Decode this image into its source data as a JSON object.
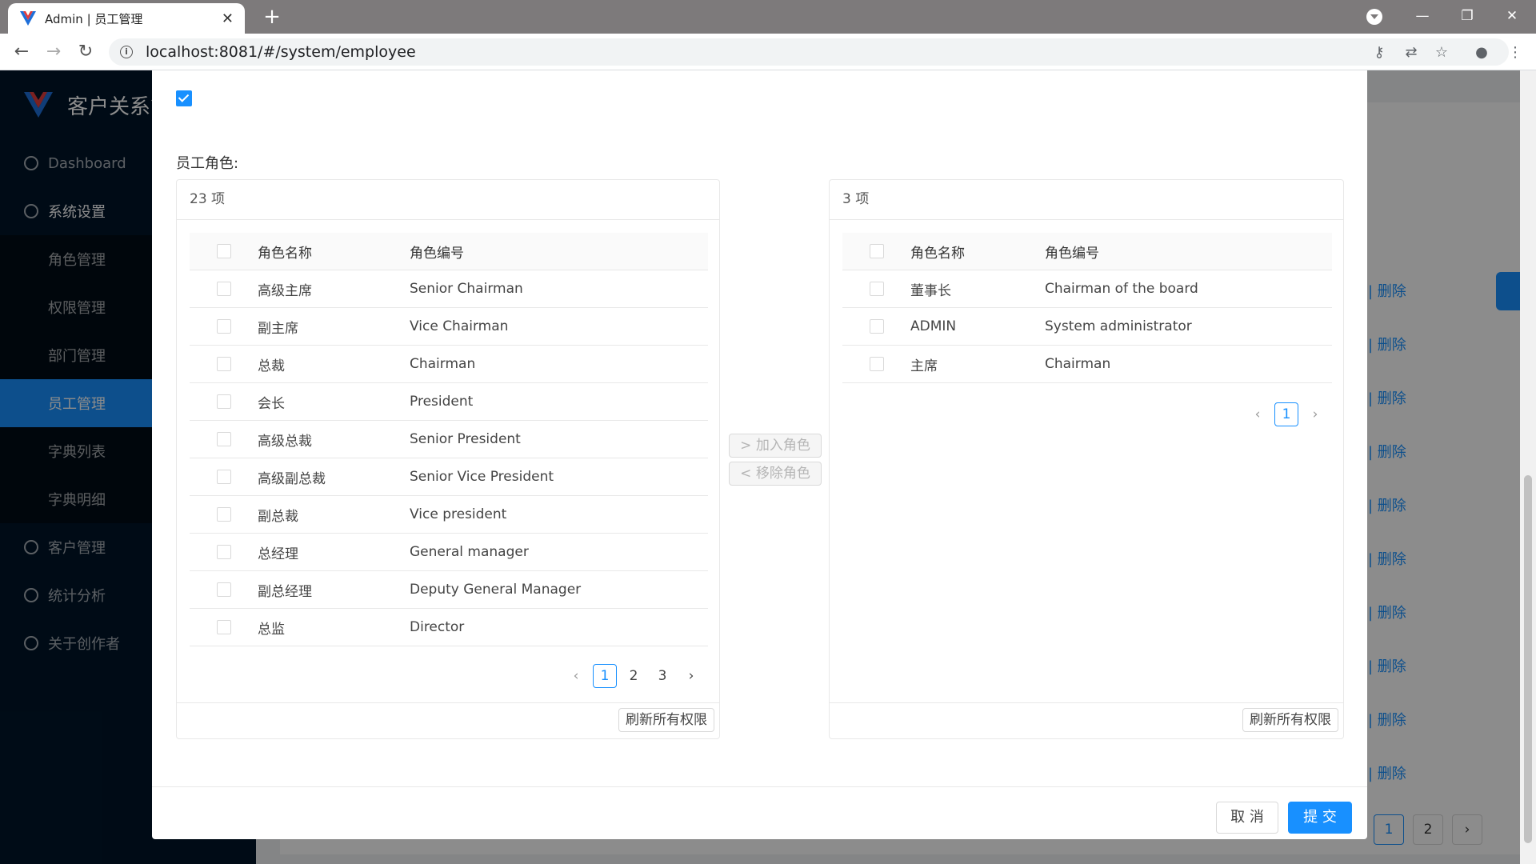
{
  "browser": {
    "tab_title": "Admin | 员工管理",
    "tab_close": "✕",
    "new_tab": "+",
    "url": "localhost:8081/#/system/employee"
  },
  "sidebar": {
    "brand": "客户关系管理",
    "items": [
      {
        "label": "Dashboard"
      },
      {
        "label": "系统设置"
      }
    ],
    "subitems": [
      {
        "label": "角色管理"
      },
      {
        "label": "权限管理"
      },
      {
        "label": "部门管理"
      },
      {
        "label": "员工管理"
      },
      {
        "label": "字典列表"
      },
      {
        "label": "字典明细"
      }
    ],
    "items_after": [
      {
        "label": "客户管理"
      },
      {
        "label": "统计分析"
      },
      {
        "label": "关于创作者"
      }
    ]
  },
  "background": {
    "delete_link": "| 删除",
    "pages": [
      "1",
      "2"
    ]
  },
  "modal": {
    "roles_label": "员工角色:",
    "left_panel": {
      "count": "23 项",
      "headers": {
        "name": "角色名称",
        "code": "角色编号"
      },
      "rows": [
        {
          "name": "高级主席",
          "code": "Senior Chairman"
        },
        {
          "name": "副主席",
          "code": "Vice Chairman"
        },
        {
          "name": "总裁",
          "code": "Chairman"
        },
        {
          "name": "会长",
          "code": "President"
        },
        {
          "name": "高级总裁",
          "code": "Senior President"
        },
        {
          "name": "高级副总裁",
          "code": "Senior Vice President"
        },
        {
          "name": "副总裁",
          "code": "Vice president"
        },
        {
          "name": "总经理",
          "code": "General manager"
        },
        {
          "name": "副总经理",
          "code": "Deputy General Manager"
        },
        {
          "name": "总监",
          "code": "Director"
        }
      ],
      "pager": {
        "pages": [
          "1",
          "2",
          "3"
        ],
        "current": "1"
      },
      "refresh": "刷新所有权限"
    },
    "right_panel": {
      "count": "3 项",
      "headers": {
        "name": "角色名称",
        "code": "角色编号"
      },
      "rows": [
        {
          "name": "董事长",
          "code": "Chairman of the board"
        },
        {
          "name": "ADMIN",
          "code": "System administrator"
        },
        {
          "name": "主席",
          "code": "Chairman"
        }
      ],
      "pager": {
        "pages": [
          "1"
        ],
        "current": "1"
      },
      "refresh": "刷新所有权限"
    },
    "add_role": ">  加入角色",
    "remove_role": "<  移除角色",
    "cancel": "取 消",
    "submit": "提 交"
  },
  "colors": {
    "primary": "#1890ff",
    "sidebar_bg": "#001529",
    "chrome_bg": "#7d7a7b"
  }
}
